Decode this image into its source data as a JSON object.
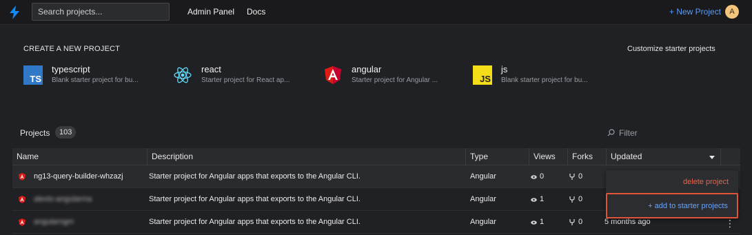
{
  "nav": {
    "search_placeholder": "Search projects...",
    "admin_panel": "Admin Panel",
    "docs": "Docs",
    "new_project": "+ New Project",
    "avatar_initial": "A"
  },
  "create": {
    "title": "CREATE A NEW PROJECT",
    "customize": "Customize starter projects",
    "starters": [
      {
        "name": "typescript",
        "desc": "Blank starter project for bu...",
        "icon": "typescript-icon",
        "icon_label": "TS"
      },
      {
        "name": "react",
        "desc": "Starter project for React ap...",
        "icon": "react-icon"
      },
      {
        "name": "angular",
        "desc": "Starter project for Angular ...",
        "icon": "angular-icon"
      },
      {
        "name": "js",
        "desc": "Blank starter project for bu...",
        "icon": "javascript-icon",
        "icon_label": "JS"
      }
    ]
  },
  "projects": {
    "title": "Projects",
    "count": "103",
    "filter_placeholder": "Filter",
    "columns": [
      "Name",
      "Description",
      "Type",
      "Views",
      "Forks",
      "Updated"
    ],
    "rows": [
      {
        "name": "ng13-query-builder-whzazj",
        "description": "Starter project for Angular apps that exports to the Angular CLI.",
        "type": "Angular",
        "views": "0",
        "forks": "0",
        "updated": ""
      },
      {
        "name": "alexlo-angularma",
        "description": "Starter project for Angular apps that exports to the Angular CLI.",
        "type": "Angular",
        "views": "1",
        "forks": "0",
        "updated": ""
      },
      {
        "name": "angularngm",
        "description": "Starter project for Angular apps that exports to the Angular CLI.",
        "type": "Angular",
        "views": "1",
        "forks": "0",
        "updated": "5 months ago"
      }
    ]
  },
  "menu": {
    "delete": "delete project",
    "add": "+ add to starter projects"
  },
  "colors": {
    "accent": "#5a9cf8",
    "danger": "#e2654f",
    "highlight_border": "#e05438",
    "angular": "#dd1b16"
  }
}
